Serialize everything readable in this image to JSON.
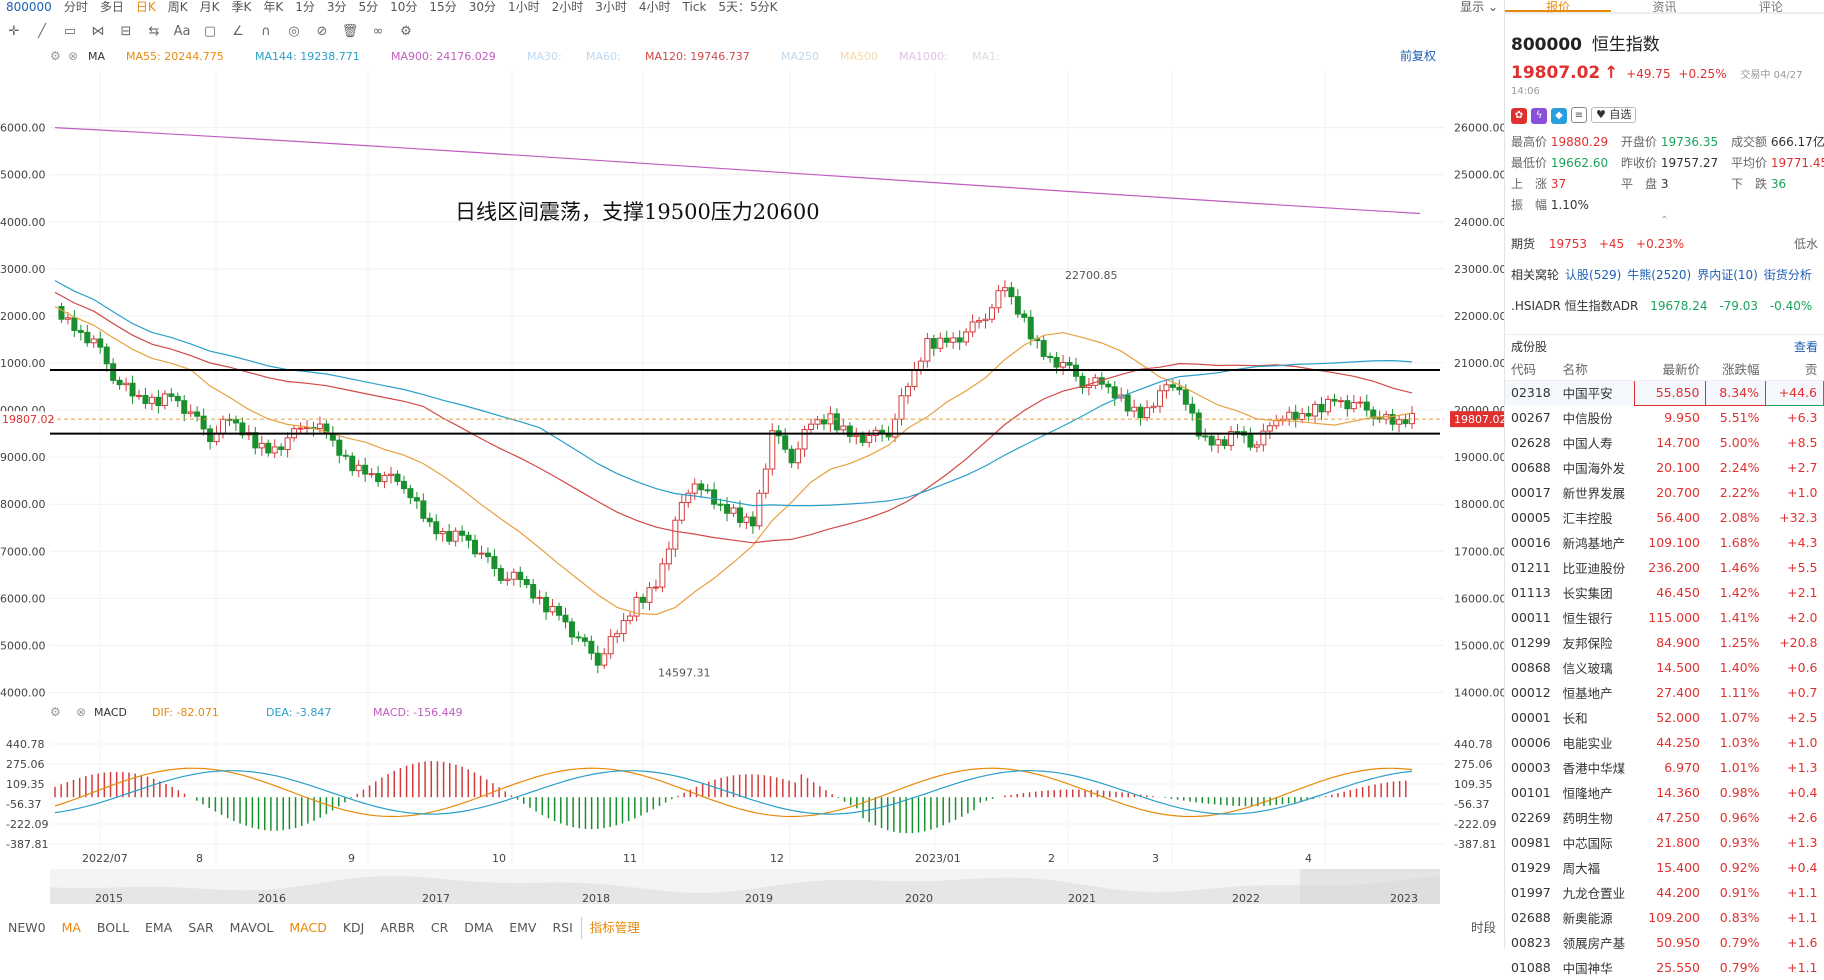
{
  "toolbar": {
    "code": "800000",
    "timeframes": [
      "分时",
      "多日",
      "日K",
      "周K",
      "月K",
      "季K",
      "年K",
      "1分",
      "3分",
      "5分",
      "10分",
      "15分",
      "30分",
      "1小时",
      "2小时",
      "3小时",
      "4小时",
      "Tick",
      "5天：5分K"
    ],
    "active_timeframe": "日K",
    "display_label": "显示"
  },
  "legend": {
    "main": [
      {
        "text": "MA",
        "color": "#333333"
      },
      {
        "text": "MA55: 20244.775",
        "color": "#e8890c"
      },
      {
        "text": "MA144: 19238.771",
        "color": "#2a9fc9"
      },
      {
        "text": "MA900: 24176.029",
        "color": "#c05cc0"
      },
      {
        "text": "MA30:",
        "color": "#bcd8f0"
      },
      {
        "text": "MA60:",
        "color": "#bcd8f0"
      },
      {
        "text": "MA120: 19746.737",
        "color": "#d04848"
      },
      {
        "text": "MA250",
        "color": "#bcd8f0"
      },
      {
        "text": "MA500",
        "color": "#f3d7a8"
      },
      {
        "text": "MA1000:",
        "color": "#e0c0e8"
      },
      {
        "text": "MA1:",
        "color": "#dddddd"
      }
    ],
    "adjust": "前复权",
    "macd": [
      {
        "text": "MACD",
        "color": "#333333"
      },
      {
        "text": "DIF: -82.071",
        "color": "#e8890c"
      },
      {
        "text": "DEA: -3.847",
        "color": "#2a9fc9"
      },
      {
        "text": "MACD: -156.449",
        "color": "#c05cc0"
      }
    ]
  },
  "chart_data": [
    {
      "type": "candlestick",
      "title": "800000 恒生指数",
      "annotation": "日线区间震荡，支撑19500压力20600",
      "left_axis_ticks": [
        "6000.00",
        "5000.00",
        "4000.00",
        "3000.00",
        "2000.00",
        "1000.00",
        "0000.00",
        "9000.00",
        "8000.00",
        "7000.00",
        "6000.00",
        "5000.00",
        "4000.00"
      ],
      "right_axis_ticks": [
        "26000.00",
        "25000.00",
        "24000.00",
        "23000.00",
        "22000.00",
        "21000.00",
        "20000.00",
        "19000.00",
        "18000.00",
        "17000.00",
        "16000.00",
        "15000.00",
        "14000.00"
      ],
      "ylim": [
        13500,
        26800
      ],
      "current_price": 19807.02,
      "high_label": "22700.85",
      "low_label": "14597.31",
      "x_labels": [
        "2022/07",
        "8",
        "9",
        "10",
        "11",
        "12",
        "2023/01",
        "2",
        "3",
        "4"
      ],
      "support_line": 19500,
      "resistance_line": 20850,
      "ma900_range": [
        26000,
        24176
      ],
      "closes_weekly": [
        22200,
        21750,
        21450,
        20750,
        20300,
        20150,
        20350,
        19900,
        19450,
        19800,
        19400,
        19150,
        19350,
        19750,
        19500,
        18900,
        18700,
        18550,
        18450,
        17700,
        17300,
        17400,
        16900,
        16500,
        16400,
        15900,
        15700,
        15100,
        14700,
        15250,
        15900,
        16300,
        17600,
        18550,
        18000,
        17800,
        17600,
        19500,
        19000,
        19700,
        19800,
        19500,
        19400,
        19550,
        20500,
        21400,
        21500,
        21600,
        22050,
        22600,
        21850,
        21200,
        20950,
        20600,
        20550,
        20200,
        19900,
        20350,
        20550,
        19450,
        19250,
        19600,
        19200,
        19900,
        19800,
        20000,
        20250,
        20100,
        19950,
        19700,
        19807
      ]
    },
    {
      "type": "macd",
      "left_axis_ticks": [
        "440.78",
        "275.06",
        "109.35",
        "-56.37",
        "-222.09",
        "-387.81"
      ],
      "right_axis_ticks": [
        "440.78",
        "275.06",
        "109.35",
        "-56.37",
        "-222.09",
        "-387.81"
      ],
      "ylim": [
        -387.81,
        440.78
      ]
    },
    {
      "type": "area",
      "name": "navigator",
      "x_labels": [
        "2015",
        "2016",
        "2017",
        "2018",
        "2019",
        "2020",
        "2021",
        "2022",
        "2023"
      ]
    }
  ],
  "indicator_tabs": [
    "NEW0",
    "MA",
    "BOLL",
    "EMA",
    "SAR",
    "MAVOL",
    "MACD",
    "KDJ",
    "ARBR",
    "CR",
    "DMA",
    "EMV",
    "RSI"
  ],
  "active_main_indicator": "MA",
  "active_sub_indicator": "MACD",
  "indicator_manager": "指标管理",
  "timeframe_button": "时段",
  "panel": {
    "tabs": [
      "报价",
      "资讯",
      "评论"
    ],
    "code": "800000",
    "name": "恒生指数",
    "price": "19807.02",
    "arrow": "↑",
    "change": "+49.75",
    "change_pct": "+0.25%",
    "trade_time": "交易中 04/27 14:06",
    "fav_label": "自选",
    "stats": [
      {
        "label": "最高价",
        "value": "19880.29",
        "color": "red"
      },
      {
        "label": "开盘价",
        "value": "19736.35",
        "color": "green"
      },
      {
        "label": "成交额",
        "value": "666.17亿",
        "color": "dark"
      },
      {
        "label": "最低价",
        "value": "19662.60",
        "color": "green"
      },
      {
        "label": "昨收价",
        "value": "19757.27",
        "color": "dark"
      },
      {
        "label": "平均价",
        "value": "19771.45",
        "color": "red"
      },
      {
        "label": "上　涨",
        "value": "37",
        "color": "red"
      },
      {
        "label": "平　盘",
        "value": "3",
        "color": "dark"
      },
      {
        "label": "下　跌",
        "value": "36",
        "color": "green"
      },
      {
        "label": "振　幅",
        "value": "1.10%",
        "color": "dark"
      }
    ],
    "futures": {
      "label": "期货",
      "price": "19753",
      "change": "+45",
      "pct": "+0.23%",
      "right": "低水"
    },
    "related": {
      "label": "相关窝轮",
      "links": [
        "认股(529)",
        "牛熊(2520)",
        "界内证(10)",
        "街货分析"
      ]
    },
    "adr": {
      "label": ".HSIADR 恒生指数ADR",
      "price": "19678.24",
      "change": "-79.03",
      "pct": "-0.40%"
    },
    "constituents_title": "成份股",
    "more": "查看",
    "columns": [
      "代码",
      "名称",
      "最新价",
      "涨跌幅",
      "贡"
    ],
    "rows": [
      [
        "02318",
        "中国平安",
        "55.850",
        "8.34%",
        "+44.6"
      ],
      [
        "00267",
        "中信股份",
        "9.950",
        "5.51%",
        "+6.3"
      ],
      [
        "02628",
        "中国人寿",
        "14.700",
        "5.00%",
        "+8.5"
      ],
      [
        "00688",
        "中国海外发",
        "20.100",
        "2.24%",
        "+2.7"
      ],
      [
        "00017",
        "新世界发展",
        "20.700",
        "2.22%",
        "+1.0"
      ],
      [
        "00005",
        "汇丰控股",
        "56.400",
        "2.08%",
        "+32.3"
      ],
      [
        "00016",
        "新鸿基地产",
        "109.100",
        "1.68%",
        "+4.3"
      ],
      [
        "01211",
        "比亚迪股份",
        "236.200",
        "1.46%",
        "+5.5"
      ],
      [
        "01113",
        "长实集团",
        "46.450",
        "1.42%",
        "+2.1"
      ],
      [
        "00011",
        "恒生银行",
        "115.000",
        "1.41%",
        "+2.0"
      ],
      [
        "01299",
        "友邦保险",
        "84.900",
        "1.25%",
        "+20.8"
      ],
      [
        "00868",
        "信义玻璃",
        "14.500",
        "1.40%",
        "+0.6"
      ],
      [
        "00012",
        "恒基地产",
        "27.400",
        "1.11%",
        "+0.7"
      ],
      [
        "00001",
        "长和",
        "52.000",
        "1.07%",
        "+2.5"
      ],
      [
        "00006",
        "电能实业",
        "44.250",
        "1.03%",
        "+1.0"
      ],
      [
        "00003",
        "香港中华煤",
        "6.970",
        "1.01%",
        "+1.3"
      ],
      [
        "00101",
        "恒隆地产",
        "14.360",
        "0.98%",
        "+0.4"
      ],
      [
        "02269",
        "药明生物",
        "47.250",
        "0.96%",
        "+2.6"
      ],
      [
        "00981",
        "中芯国际",
        "21.800",
        "0.93%",
        "+1.3"
      ],
      [
        "01929",
        "周大福",
        "15.400",
        "0.92%",
        "+0.4"
      ],
      [
        "01997",
        "九龙仓置业",
        "44.200",
        "0.91%",
        "+1.1"
      ],
      [
        "02688",
        "新奥能源",
        "109.200",
        "0.83%",
        "+1.1"
      ],
      [
        "00823",
        "领展房产基",
        "50.950",
        "0.79%",
        "+1.6"
      ],
      [
        "01088",
        "中国神华",
        "25.550",
        "0.79%",
        "+1.1"
      ]
    ]
  }
}
